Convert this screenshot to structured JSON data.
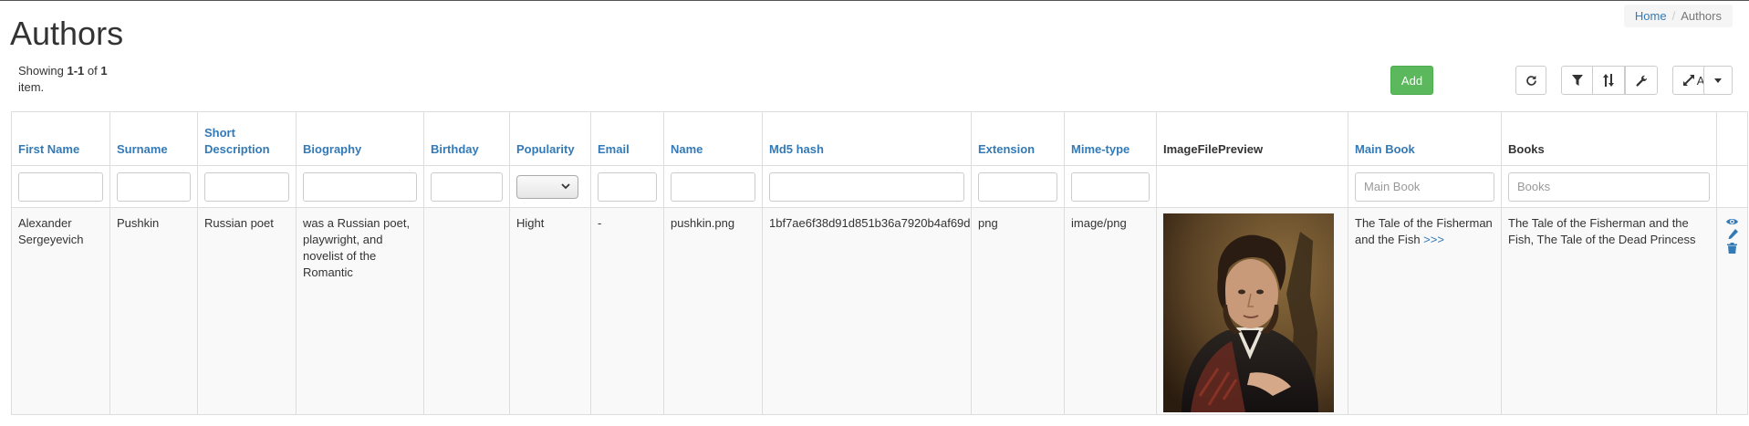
{
  "page": {
    "title": "Authors"
  },
  "breadcrumb": {
    "home": "Home",
    "current": "Authors"
  },
  "summary": {
    "prefix": "Showing ",
    "range": "1-1",
    "of": " of ",
    "total": "1",
    "suffix": "item."
  },
  "toolbar": {
    "add_label": "Add",
    "all_label": "All",
    "icons": [
      "refresh-icon",
      "filter-icon",
      "sort-icon",
      "wrench-icon",
      "expand-icon",
      "caret-down-icon"
    ]
  },
  "columns": [
    {
      "label": "First Name",
      "sortable": true
    },
    {
      "label": "Surname",
      "sortable": true
    },
    {
      "label": "Short Description",
      "sortable": true
    },
    {
      "label": "Biography",
      "sortable": true
    },
    {
      "label": "Birthday",
      "sortable": true
    },
    {
      "label": "Popularity",
      "sortable": true
    },
    {
      "label": "Email",
      "sortable": true
    },
    {
      "label": "Name",
      "sortable": true
    },
    {
      "label": "Md5 hash",
      "sortable": true
    },
    {
      "label": "Extension",
      "sortable": true
    },
    {
      "label": "Mime-type",
      "sortable": true
    },
    {
      "label": "ImageFilePreview",
      "sortable": false
    },
    {
      "label": "Main Book",
      "sortable": true
    },
    {
      "label": "Books",
      "sortable": false
    }
  ],
  "filters": {
    "main_book_placeholder": "Main Book",
    "books_placeholder": "Books"
  },
  "rows": [
    {
      "first_name": "Alexander Sergeyevich",
      "surname": "Pushkin",
      "short_description": "Russian poet",
      "biography": "was a Russian poet, playwright, and novelist of the Romantic",
      "birthday": "",
      "popularity": "Hight",
      "email": "-",
      "name": "pushkin.png",
      "md5": "1bf7ae6f38d91d851b36a7920b4af69d",
      "extension": "png",
      "mime": "image/png",
      "image": "portrait of Pushkin",
      "main_book": "The Tale of the Fisherman and the Fish",
      "main_book_link": ">>>",
      "books": "The Tale of the Fisherman and the Fish, The Tale of the Dead Princess",
      "action_icons": [
        "eye-icon",
        "pencil-icon",
        "trash-icon"
      ]
    }
  ],
  "colors": {
    "link": "#337ab7",
    "add": "#5cb85c",
    "border": "#dddddd",
    "row_bg": "#f9f9f9"
  }
}
